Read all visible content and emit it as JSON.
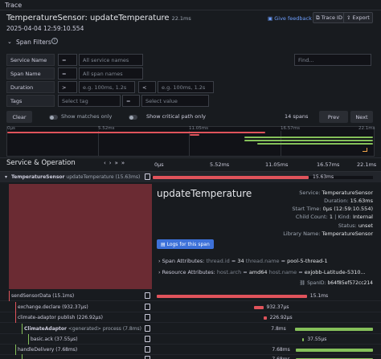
{
  "header": {
    "section_label": "Trace",
    "title": "TemperatureSensor: updateTemperature",
    "duration": "22.1ms",
    "date": "2025-04-04 12:59:10.554",
    "feedback_label": "Give feedback",
    "trace_id_label": "Trace ID",
    "export_label": "Export"
  },
  "span_filters": {
    "label": "Span Filters",
    "service_name": {
      "label": "Service Name",
      "op": "=",
      "placeholder": "All service names"
    },
    "span_name": {
      "label": "Span Name",
      "op": "=",
      "placeholder": "All span names"
    },
    "duration": {
      "label": "Duration",
      "op1": ">",
      "ph1": "e.g. 100ms, 1.2s",
      "op2": "<",
      "ph2": "e.g. 100ms, 1.2s"
    },
    "tags": {
      "label": "Tags",
      "placeholder": "Select tag",
      "op": "=",
      "value_placeholder": "Select value"
    },
    "find_placeholder": "Find...",
    "clear_label": "Clear",
    "show_matches_label": "Show matches only",
    "show_critical_label": "Show critical path only",
    "span_count": "14 spans",
    "prev_label": "Prev",
    "next_label": "Next"
  },
  "minimap": {
    "ticks": [
      "0μs",
      "5.52ms",
      "11.05ms",
      "16.57ms",
      "22.1ms"
    ]
  },
  "timeline": {
    "header": "Service & Operation",
    "axis": [
      "0μs",
      "5.52ms",
      "11.05ms",
      "16.57ms",
      "22.1ms"
    ]
  },
  "rows": [
    {
      "name": "TemperatureSensor",
      "op": "updateTemperature (15.63ms)",
      "dur": "15.63ms",
      "start": 0.0,
      "len": 0.707,
      "color": "red"
    },
    {
      "name": "sendSensorData (15.1ms)",
      "op": "",
      "dur": "15.1ms",
      "start": 0.02,
      "len": 0.68,
      "color": "red"
    },
    {
      "name": "exchange.declare (932.37μs)",
      "op": "",
      "dur": "932.37μs",
      "start": 0.46,
      "len": 0.042,
      "color": "red"
    },
    {
      "name": "climate-adaptor publish (226.92μs)",
      "op": "",
      "dur": "226.92μs",
      "start": 0.505,
      "len": 0.012,
      "color": "red"
    },
    {
      "name": "ClimateAdaptor",
      "op": "<generated> process (7.8ms)",
      "dur": "7.8ms",
      "start": 0.647,
      "len": 0.353,
      "color": "green"
    },
    {
      "name": "basic.ack (37.55μs)",
      "op": "",
      "dur": "37.55μs",
      "start": 0.68,
      "len": 0.005,
      "color": "green"
    },
    {
      "name": "handleDelivery (7.68ms)",
      "op": "",
      "dur": "7.68ms",
      "start": 0.651,
      "len": 0.348,
      "color": "green"
    },
    {
      "name": "",
      "op": "",
      "dur": "7.68ms",
      "start": 0.651,
      "len": 0.348,
      "color": "green"
    }
  ],
  "detail": {
    "op_title": "updateTemperature",
    "service_label": "Service:",
    "service": "TemperatureSensor",
    "duration_label": "Duration:",
    "duration": "15.63ms",
    "start_label": "Start Time:",
    "start": "0μs (12:59:10.554)",
    "child_label": "Child Count:",
    "child": "1",
    "kind_label": "Kind:",
    "kind": "Internal",
    "status_label": "Status:",
    "status": "unset",
    "library_label": "Library Name:",
    "library": "TemperatureSensor",
    "logs_button": "Logs for this span",
    "span_attr_label": "Span Attributes:",
    "span_attr_k1": "thread.id",
    "span_attr_v1": "34",
    "span_attr_k2": "thread.name",
    "span_attr_v2": "pool-5-thread-1",
    "res_attr_label": "Resource Attributes:",
    "res_attr_k1": "host.arch",
    "res_attr_v1": "amd64",
    "res_attr_k2": "host.name",
    "res_attr_v2": "exjobb-Latitude-5310...",
    "span_id_label": "SpanID:",
    "span_id": "b64f85ef572cc214"
  },
  "colors": {
    "red": "#e0535b",
    "green": "#85c05a",
    "accent": "#3d71d9",
    "link": "#6e9fff"
  }
}
